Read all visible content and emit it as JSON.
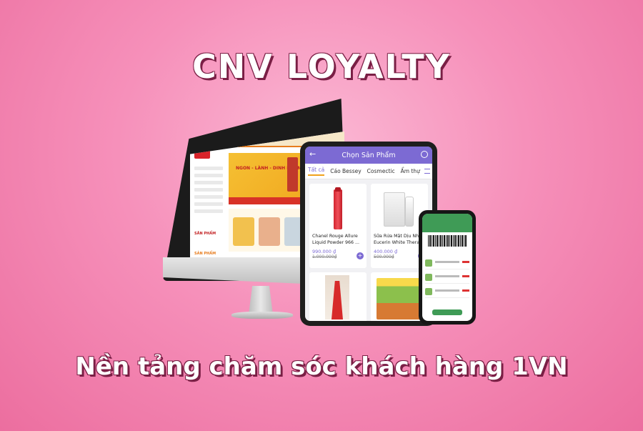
{
  "title": "CNV LOYALTY",
  "subtitle": "Nền tảng chăm sóc khách hàng 1VN",
  "colors": {
    "background": "#f690ba",
    "tablet_accent": "#7c6ad3",
    "phone_accent": "#3f9b56",
    "text_outline": "#7a1f45"
  },
  "tablet": {
    "header_title": "Chọn Sản Phẩm",
    "tabs": [
      "Tất cả",
      "Cáo Bessey",
      "Cosmectic",
      "Ẩm thự"
    ],
    "products": [
      {
        "name": "Chanel Rouge Allure\nLiquid Powder 966 ...",
        "price": "990.000 ₫",
        "old_price": "1.000.000₫"
      },
      {
        "name": "Sữa Rửa Mặt Dịu Nhẹ\nEucerin White Thera...",
        "price": "400.000 ₫",
        "old_price": "500.000₫"
      }
    ],
    "add_symbol": "+"
  },
  "desktop": {
    "banner_tag": "NGON - LÀNH - DINH DƯỠNG",
    "label_1": "SĂN PHẨM",
    "label_2": "SẢN PHẨM"
  }
}
